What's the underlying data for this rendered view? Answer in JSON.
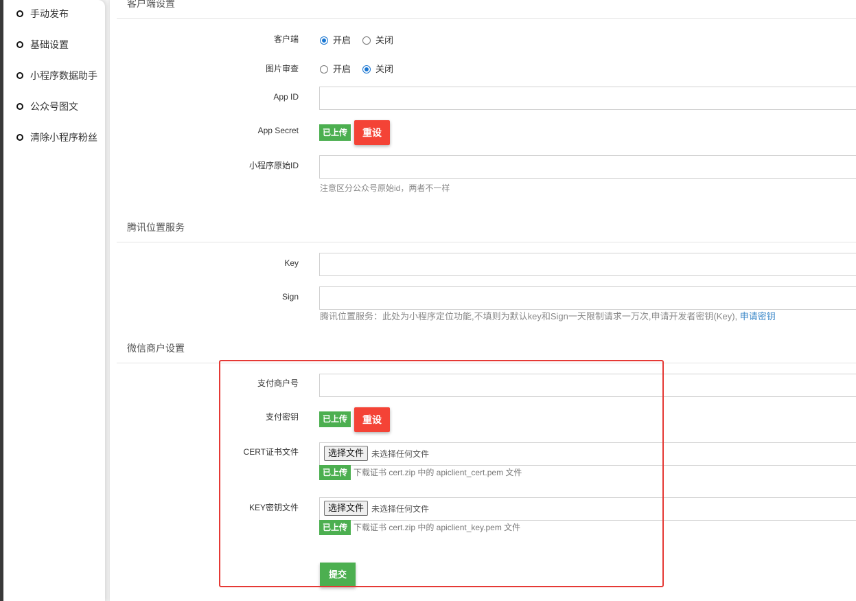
{
  "theme": {
    "primary": "#1976d2",
    "success": "#4caf50",
    "danger": "#f44336",
    "link": "#3a87c8",
    "annotation": "#e53935"
  },
  "sidebar": {
    "items": [
      {
        "label": "手动发布",
        "icon": "circle-bullet-icon"
      },
      {
        "label": "基础设置",
        "icon": "circle-bullet-icon"
      },
      {
        "label": "小程序数据助手",
        "icon": "circle-bullet-icon"
      },
      {
        "label": "公众号图文",
        "icon": "circle-bullet-icon"
      },
      {
        "label": "清除小程序粉丝",
        "icon": "circle-bullet-icon"
      }
    ]
  },
  "client_settings": {
    "heading": "客户端设置",
    "client": {
      "label": "客户端",
      "options": [
        {
          "label": "开启",
          "checked": true
        },
        {
          "label": "关闭",
          "checked": false
        }
      ]
    },
    "image_review": {
      "label": "图片审查",
      "options": [
        {
          "label": "开启",
          "checked": false
        },
        {
          "label": "关闭",
          "checked": true
        }
      ]
    },
    "app_id": {
      "label": "App ID",
      "value": ""
    },
    "app_secret": {
      "label": "App Secret",
      "status": "已上传",
      "reset": "重设"
    },
    "original_id": {
      "label": "小程序原始ID",
      "value": "",
      "help": "注意区分公众号原始id，两者不一样"
    }
  },
  "tencent_location": {
    "heading": "腾讯位置服务",
    "key": {
      "label": "Key",
      "value": ""
    },
    "sign": {
      "label": "Sign",
      "value": ""
    },
    "help": "腾讯位置服务：此处为小程序定位功能,不填则为默认key和Sign一天限制请求一万次,申请开发者密钥(Key), ",
    "help_link": "申请密钥"
  },
  "wechat_merchant": {
    "heading": "微信商户设置",
    "merchant_id": {
      "label": "支付商户号",
      "value": ""
    },
    "pay_key": {
      "label": "支付密钥",
      "status": "已上传",
      "reset": "重设"
    },
    "cert_file": {
      "label": "CERT证书文件",
      "choose_button": "选择文件",
      "no_file": "未选择任何文件",
      "status": "已上传",
      "help": "下载证书 cert.zip 中的 apiclient_cert.pem 文件"
    },
    "key_file": {
      "label": "KEY密钥文件",
      "choose_button": "选择文件",
      "no_file": "未选择任何文件",
      "status": "已上传",
      "help": "下载证书 cert.zip 中的 apiclient_key.pem 文件"
    },
    "submit": "提交"
  }
}
